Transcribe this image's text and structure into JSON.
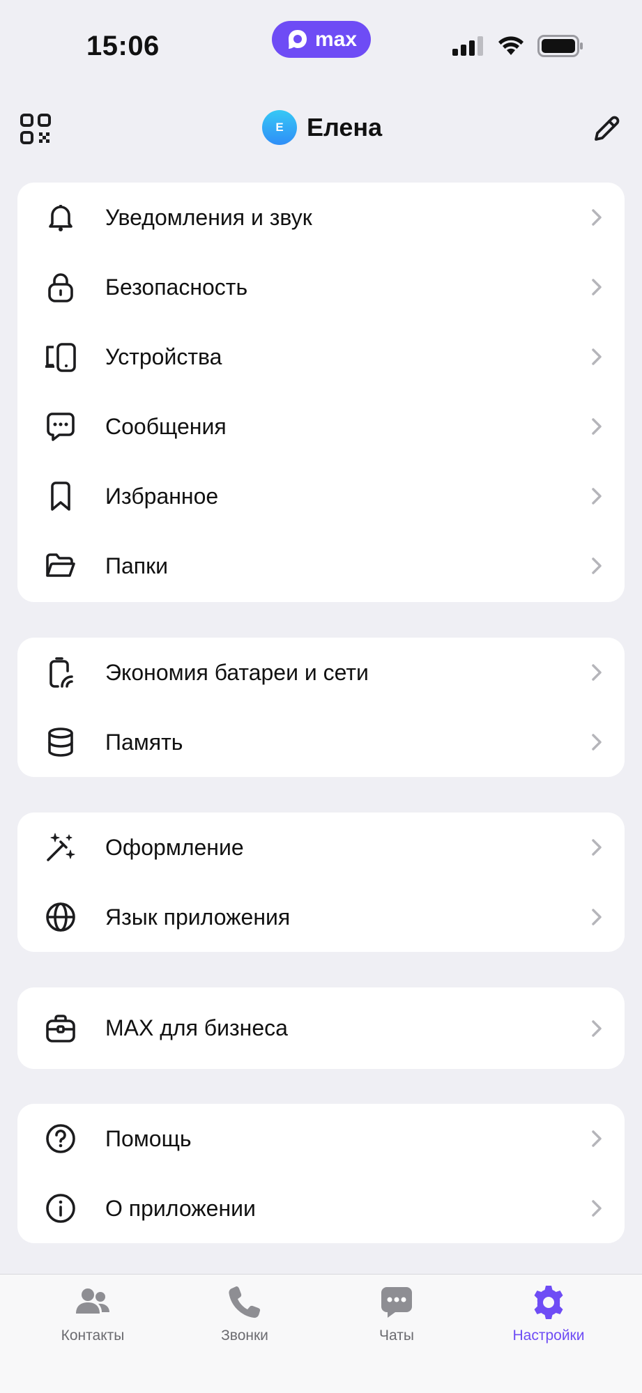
{
  "status_bar": {
    "time": "15:06",
    "app_pill": "max",
    "pill_color": "#6e4cf5"
  },
  "header": {
    "avatar_initial": "Е",
    "profile_name": "Елена",
    "left_icon": "qr-code-icon",
    "right_icon": "pencil-icon"
  },
  "groups": [
    {
      "items": [
        {
          "icon": "bell-icon",
          "label": "Уведомления и звук"
        },
        {
          "icon": "lock-icon",
          "label": "Безопасность"
        },
        {
          "icon": "devices-icon",
          "label": "Устройства"
        },
        {
          "icon": "chat-bubble-icon",
          "label": "Сообщения"
        },
        {
          "icon": "bookmark-icon",
          "label": "Избранное"
        },
        {
          "icon": "folder-icon",
          "label": "Папки"
        }
      ]
    },
    {
      "items": [
        {
          "icon": "battery-saver-icon",
          "label": "Экономия батареи и сети"
        },
        {
          "icon": "database-icon",
          "label": "Память"
        }
      ]
    },
    {
      "items": [
        {
          "icon": "magic-wand-icon",
          "label": "Оформление"
        },
        {
          "icon": "globe-icon",
          "label": "Язык приложения"
        }
      ]
    },
    {
      "items": [
        {
          "icon": "briefcase-icon",
          "label": "MAX для бизнеса"
        }
      ]
    },
    {
      "items": [
        {
          "icon": "help-icon",
          "label": "Помощь"
        },
        {
          "icon": "info-icon",
          "label": "О приложении"
        }
      ]
    }
  ],
  "tabbar": {
    "tabs": [
      {
        "icon": "contacts-icon",
        "label": "Контакты",
        "active": false
      },
      {
        "icon": "phone-icon",
        "label": "Звонки",
        "active": false
      },
      {
        "icon": "chats-icon",
        "label": "Чаты",
        "active": false
      },
      {
        "icon": "settings-gear-icon",
        "label": "Настройки",
        "active": true
      }
    ],
    "active_color": "#6e4cf5",
    "inactive_color": "#8e8e93"
  }
}
